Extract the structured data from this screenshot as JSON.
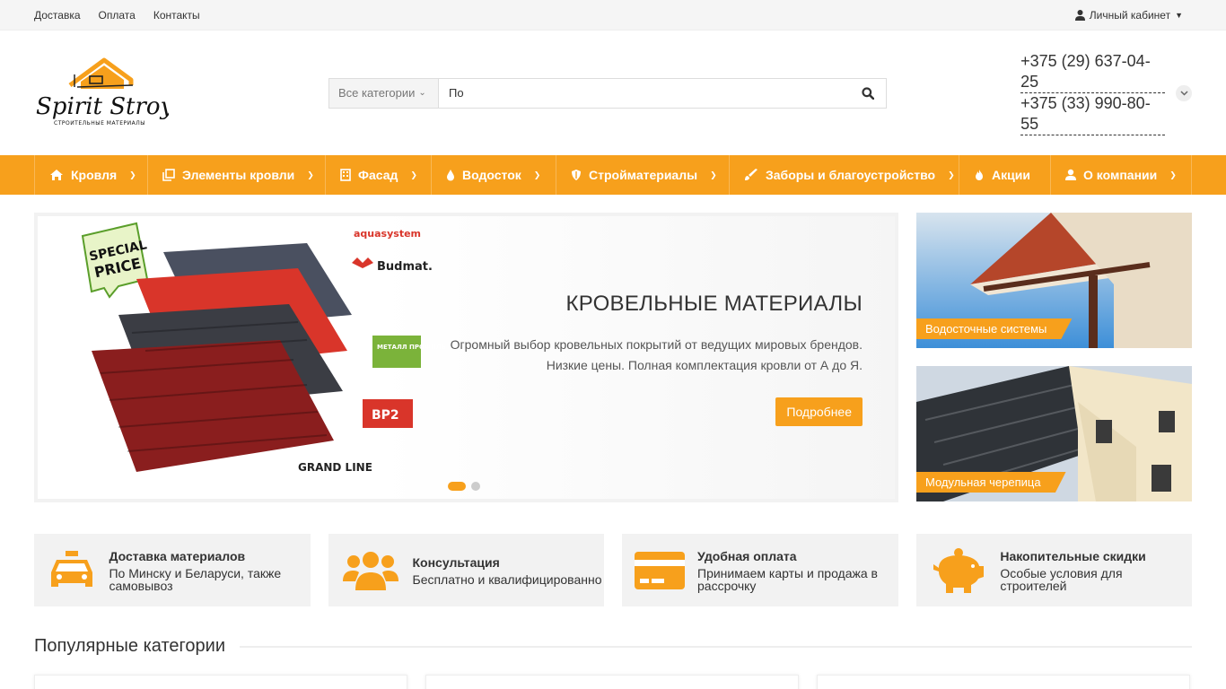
{
  "topbar": {
    "links": [
      "Доставка",
      "Оплата",
      "Контакты"
    ],
    "cabinet": "Личный кабинет"
  },
  "header": {
    "logo_text": "Spirit Stroy",
    "logo_sub": "СТРОИТЕЛЬНЫЕ МАТЕРИАЛЫ",
    "search": {
      "category": "Все категории",
      "value": "По"
    },
    "phones": [
      "+375 (29) 637-04-25",
      "+375 (33) 990-80-55"
    ]
  },
  "nav": {
    "items": [
      {
        "label": "Кровля",
        "icon": "home-icon"
      },
      {
        "label": "Элементы кровли",
        "icon": "copy-icon"
      },
      {
        "label": "Фасад",
        "icon": "building-icon"
      },
      {
        "label": "Водосток",
        "icon": "drop-icon"
      },
      {
        "label": "Стройматериалы",
        "icon": "shield-icon"
      },
      {
        "label": "Заборы и благоустройство",
        "icon": "paint-icon"
      },
      {
        "label": "Акции",
        "icon": "fire-icon"
      },
      {
        "label": "О компании",
        "icon": "user-icon"
      }
    ]
  },
  "slider": {
    "title": "КРОВЕЛЬНЫЕ МАТЕРИАЛЫ",
    "text": "Огромный выбор кровельных покрытий от ведущих мировых брендов. Низкие цены. Полная комплектация кровли от А до Я.",
    "button": "Подробнее",
    "badge": [
      "SPECIAL",
      "PRICE"
    ],
    "brands": [
      "aquasystem",
      "Budmat.",
      "МЕТАЛЛ ПРОФИЛЬ",
      "BP2",
      "GRAND LINE"
    ]
  },
  "banners": [
    "Водосточные системы",
    "Модульная черепица"
  ],
  "features": [
    {
      "title": "Доставка материалов",
      "text": "По Минску и Беларуси, также самовывоз"
    },
    {
      "title": "Консультация",
      "text": "Бесплатно и квалифицированно"
    },
    {
      "title": "Удобная оплата",
      "text": "Принимаем карты и продажа в рассрочку"
    },
    {
      "title": "Накопительные скидки",
      "text": "Особые условия для строителей"
    }
  ],
  "popular_title": "Популярные категории",
  "colors": {
    "accent": "#f7a01c"
  }
}
